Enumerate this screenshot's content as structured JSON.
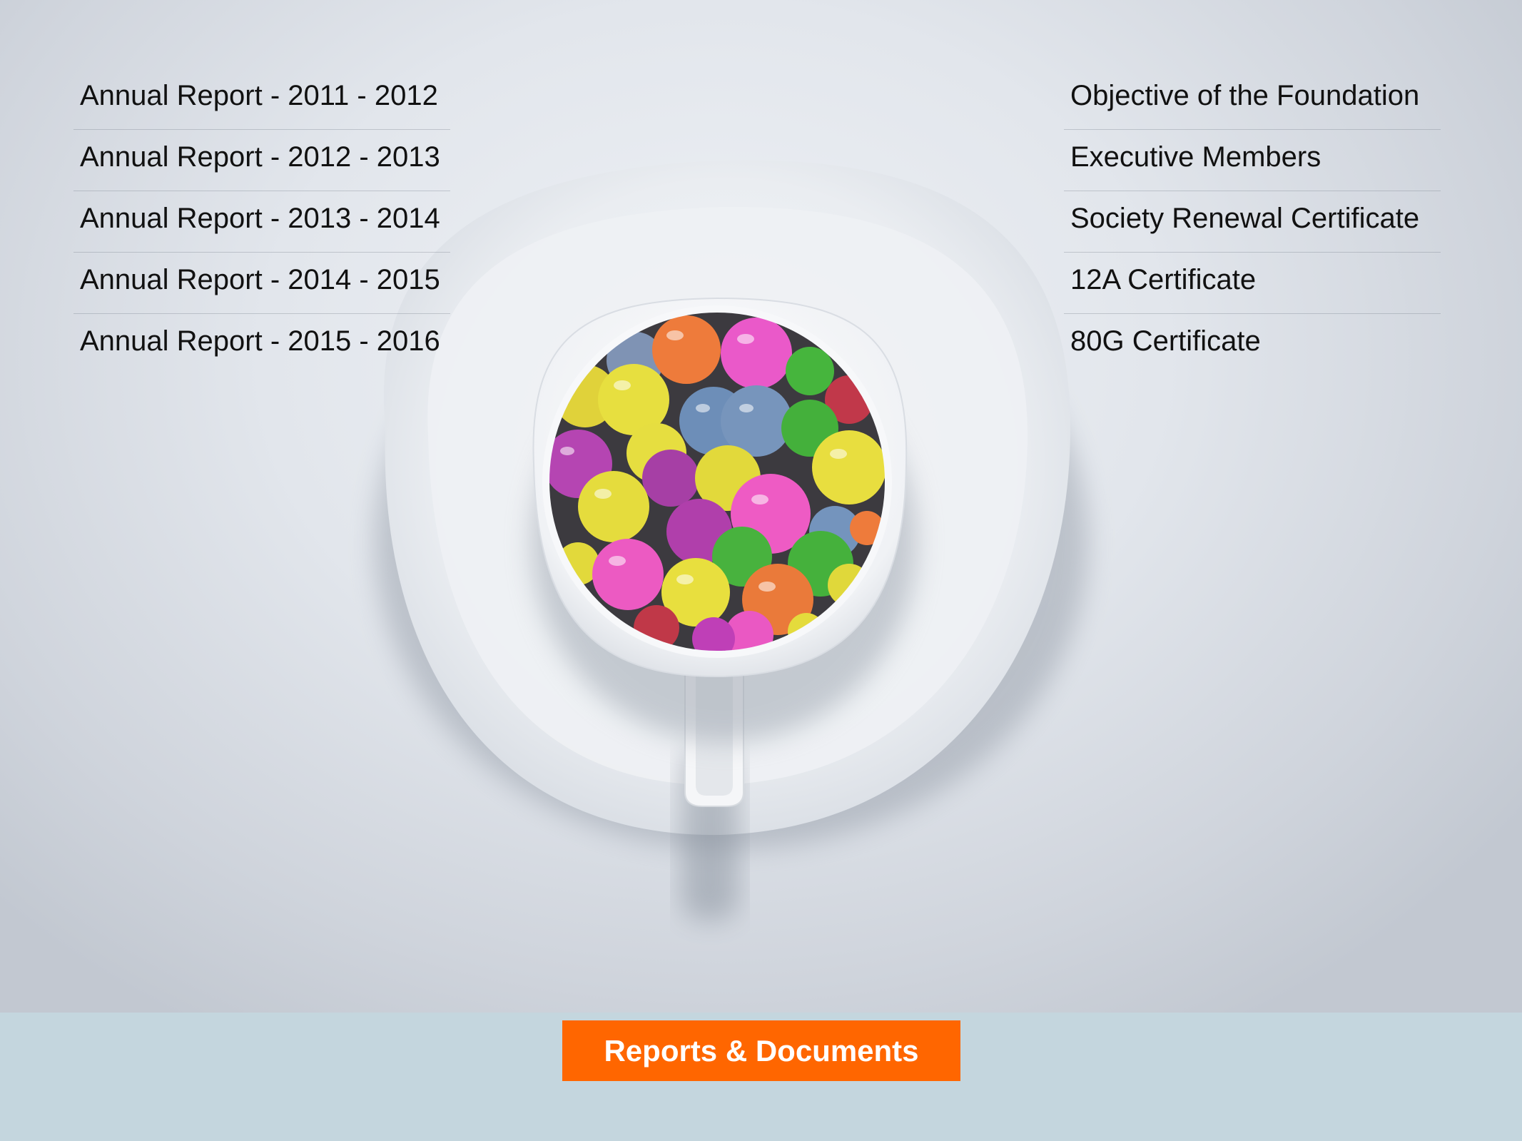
{
  "left_links": [
    {
      "label": "Annual Report - 2011 - 2012"
    },
    {
      "label": "Annual Report - 2012 - 2013"
    },
    {
      "label": "Annual Report - 2013 - 2014"
    },
    {
      "label": "Annual Report - 2014 - 2015"
    },
    {
      "label": "Annual Report - 2015 - 2016"
    }
  ],
  "right_links": [
    {
      "label": "Objective of the Foundation"
    },
    {
      "label": "Executive Members"
    },
    {
      "label": "Society Renewal Certificate"
    },
    {
      "label": "12A Certificate"
    },
    {
      "label": "80G Certificate"
    }
  ],
  "footer": {
    "button_label": "Reports & Documents"
  },
  "colors": {
    "accent": "#ff6600",
    "footer_bg": "#c4d6de",
    "link_text": "#111111"
  },
  "hero_image": {
    "icon": "candy-cup-image"
  }
}
